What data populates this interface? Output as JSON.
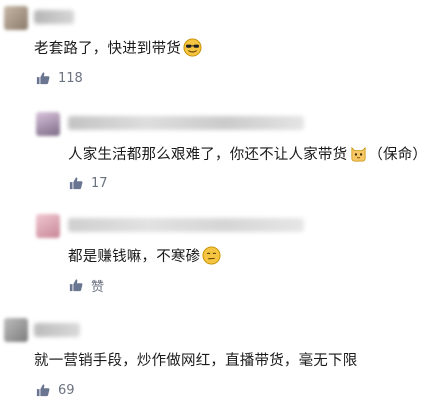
{
  "comments": [
    {
      "text": "老套路了，快进到带货",
      "emoji": "cool-sunglasses-emoji",
      "likes": "118"
    },
    {
      "text": "人家生活都那么艰难了，你还不让人家带货",
      "emoji": "cat-emoji",
      "text_suffix": "（保命）",
      "likes": "17"
    },
    {
      "text": "都是赚钱嘛，不寒碜",
      "emoji": "thinking-emoji",
      "likes": "赞"
    },
    {
      "text": "就一营销手段，炒作做网红，直播带货，毫无下限",
      "likes": "69"
    }
  ],
  "colors": {
    "text": "#1a1a1a",
    "meta": "#6b7280",
    "like_icon": "#6a7591",
    "divider": "#eeeeee"
  },
  "icons": {
    "like": "thumbs-up-icon"
  }
}
